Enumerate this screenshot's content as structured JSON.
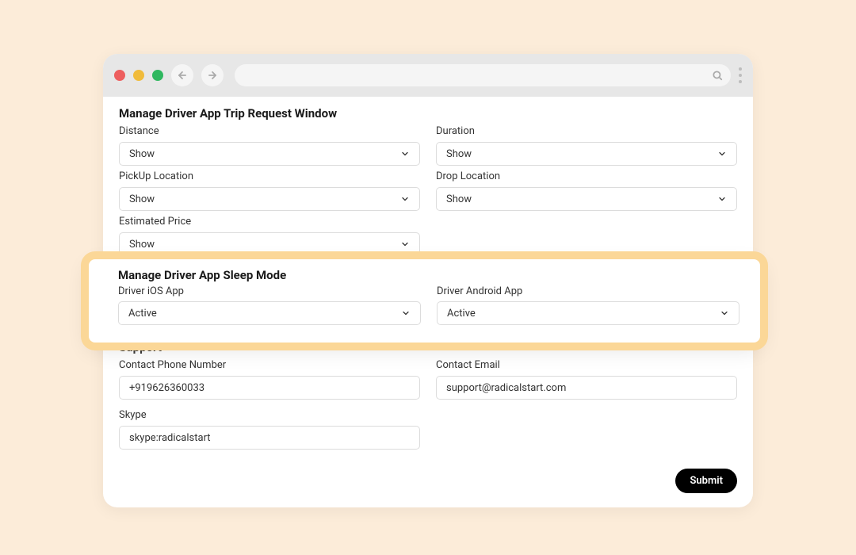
{
  "sections": {
    "trip_request": {
      "title": "Manage Driver App Trip Request Window",
      "fields": {
        "distance": {
          "label": "Distance",
          "value": "Show"
        },
        "duration": {
          "label": "Duration",
          "value": "Show"
        },
        "pickup": {
          "label": "PickUp Location",
          "value": "Show"
        },
        "drop": {
          "label": "Drop Location",
          "value": "Show"
        },
        "price": {
          "label": "Estimated Price",
          "value": "Show"
        }
      }
    },
    "sleep_mode": {
      "title": "Manage Driver App Sleep Mode",
      "fields": {
        "ios": {
          "label": "Driver iOS App",
          "value": "Active"
        },
        "android": {
          "label": "Driver Android App",
          "value": "Active"
        }
      }
    },
    "support": {
      "title": "Support",
      "fields": {
        "phone": {
          "label": "Contact Phone Number",
          "value": "+919626360033"
        },
        "email": {
          "label": "Contact Email",
          "value": "support@radicalstart.com"
        },
        "skype": {
          "label": "Skype",
          "value": "skype:radicalstart"
        }
      }
    }
  },
  "buttons": {
    "submit": "Submit"
  }
}
